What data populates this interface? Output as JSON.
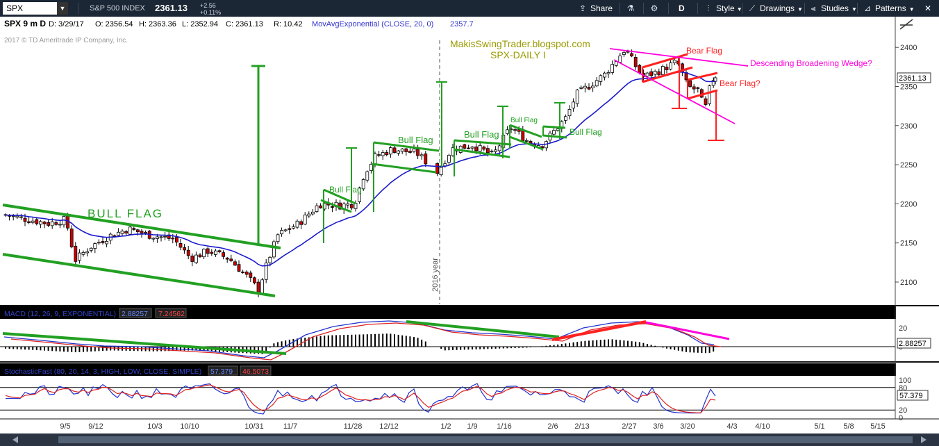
{
  "toolbar": {
    "symbol": "SPX",
    "symbol_dropdown": "▼",
    "name": "S&P 500 INDEX",
    "price": "2361.13",
    "change": "+2.56",
    "change_pct": "+0.11%",
    "share": "Share",
    "period": "D",
    "style": "Style",
    "drawings": "Drawings",
    "studies": "Studies",
    "patterns": "Patterns",
    "close": "✕",
    "icons": [
      "share-icon",
      "flask-icon",
      "gear-icon",
      "style-icon",
      "drawings-icon",
      "studies-icon",
      "patterns-icon",
      "close-icon"
    ]
  },
  "chart_data": [
    {
      "type": "candlestick",
      "title": "SPX 9 m D",
      "info": {
        "date": "D: 3/29/17",
        "open": "O: 2356.54",
        "high": "H: 2363.36",
        "low": "L: 2352.94",
        "close": "C: 2361.13",
        "range": "R: 10.42",
        "study": "MovAvgExponential (CLOSE, 20, 0)",
        "study_value": "2357.7"
      },
      "copyright": "2017 © TD Ameritrade IP Company, Inc.",
      "site_title": "MakisSwingTrader.blogspot.com",
      "site_subtitle": "SPX-DAILY  I",
      "year_marker": "2016 year",
      "last_price_label": "2361.13",
      "y_ticks": [
        2100,
        2150,
        2200,
        2250,
        2300,
        2350,
        2400
      ],
      "ylim": [
        2075,
        2420
      ],
      "annotations": [
        "BULL  FLAG",
        "Bull Flag",
        "Bull Flag",
        "Bull Flag",
        "Bull Flag",
        "Bull Flag",
        "Bear Flag",
        "Bear Flag?",
        "Descending Broadening Wedge?"
      ],
      "ohlc_sample": [
        {
          "x": "9/5",
          "open": 2180,
          "high": 2186,
          "low": 2176,
          "close": 2184
        },
        {
          "x": "9/12",
          "open": 2128,
          "high": 2152,
          "low": 2120,
          "close": 2147
        },
        {
          "x": "10/3",
          "open": 2162,
          "high": 2166,
          "low": 2150,
          "close": 2154
        },
        {
          "x": "10/10",
          "open": 2150,
          "high": 2152,
          "low": 2128,
          "close": 2133
        },
        {
          "x": "10/31",
          "open": 2103,
          "high": 2106,
          "low": 2084,
          "close": 2088
        },
        {
          "x": "11/7",
          "open": 2132,
          "high": 2166,
          "low": 2130,
          "close": 2164
        },
        {
          "x": "11/28",
          "open": 2207,
          "high": 2213,
          "low": 2192,
          "close": 2196
        },
        {
          "x": "12/12",
          "open": 2258,
          "high": 2278,
          "low": 2254,
          "close": 2270
        },
        {
          "x": "1/2",
          "open": 2242,
          "high": 2258,
          "low": 2238,
          "close": 2257
        },
        {
          "x": "1/9",
          "open": 2270,
          "high": 2276,
          "low": 2266,
          "close": 2274
        },
        {
          "x": "1/16",
          "open": 2270,
          "high": 2276,
          "low": 2260,
          "close": 2263
        },
        {
          "x": "2/6",
          "open": 2292,
          "high": 2300,
          "low": 2288,
          "close": 2294
        },
        {
          "x": "2/13",
          "open": 2330,
          "high": 2350,
          "low": 2328,
          "close": 2347
        },
        {
          "x": "2/27",
          "open": 2390,
          "high": 2400,
          "low": 2362,
          "close": 2366
        },
        {
          "x": "3/6",
          "open": 2372,
          "high": 2380,
          "low": 2356,
          "close": 2365
        },
        {
          "x": "3/20",
          "open": 2372,
          "high": 2376,
          "low": 2338,
          "close": 2344
        },
        {
          "x": "3/29",
          "open": 2356.54,
          "high": 2363.36,
          "low": 2352.94,
          "close": 2361.13
        }
      ]
    },
    {
      "type": "line",
      "title": "MACD (12, 26, 9, EXPONENTIAL)",
      "value_1": "2.88257",
      "value_2": "7.24562",
      "y_ticks": [
        20,
        0
      ],
      "last_label": "2.88257"
    },
    {
      "type": "line",
      "title": "StochasticFast (80, 20, 14, 3, HIGH, LOW, CLOSE, SIMPLE)",
      "value_1": "57.379",
      "value_2": "46.5073",
      "y_ticks": [
        100,
        80,
        20,
        0
      ],
      "last_label": "57.379"
    }
  ],
  "x_axis": [
    "9/5",
    "9/12",
    "10/3",
    "10/10",
    "10/31",
    "11/7",
    "11/28",
    "12/12",
    "1/2",
    "1/9",
    "1/16",
    "2/6",
    "2/13",
    "2/27",
    "3/6",
    "3/20",
    "4/3",
    "4/10",
    "5/1",
    "5/8",
    "5/15"
  ],
  "colors": {
    "bull": "#ffffff",
    "bear": "#cc0000",
    "ema": "#1a1acc",
    "trendline": "#22a022",
    "bear_line": "#ff2222",
    "wedge": "#ff00dd",
    "annotation_olive": "#9a9a00",
    "toolbar_bg": "#1c2735"
  }
}
